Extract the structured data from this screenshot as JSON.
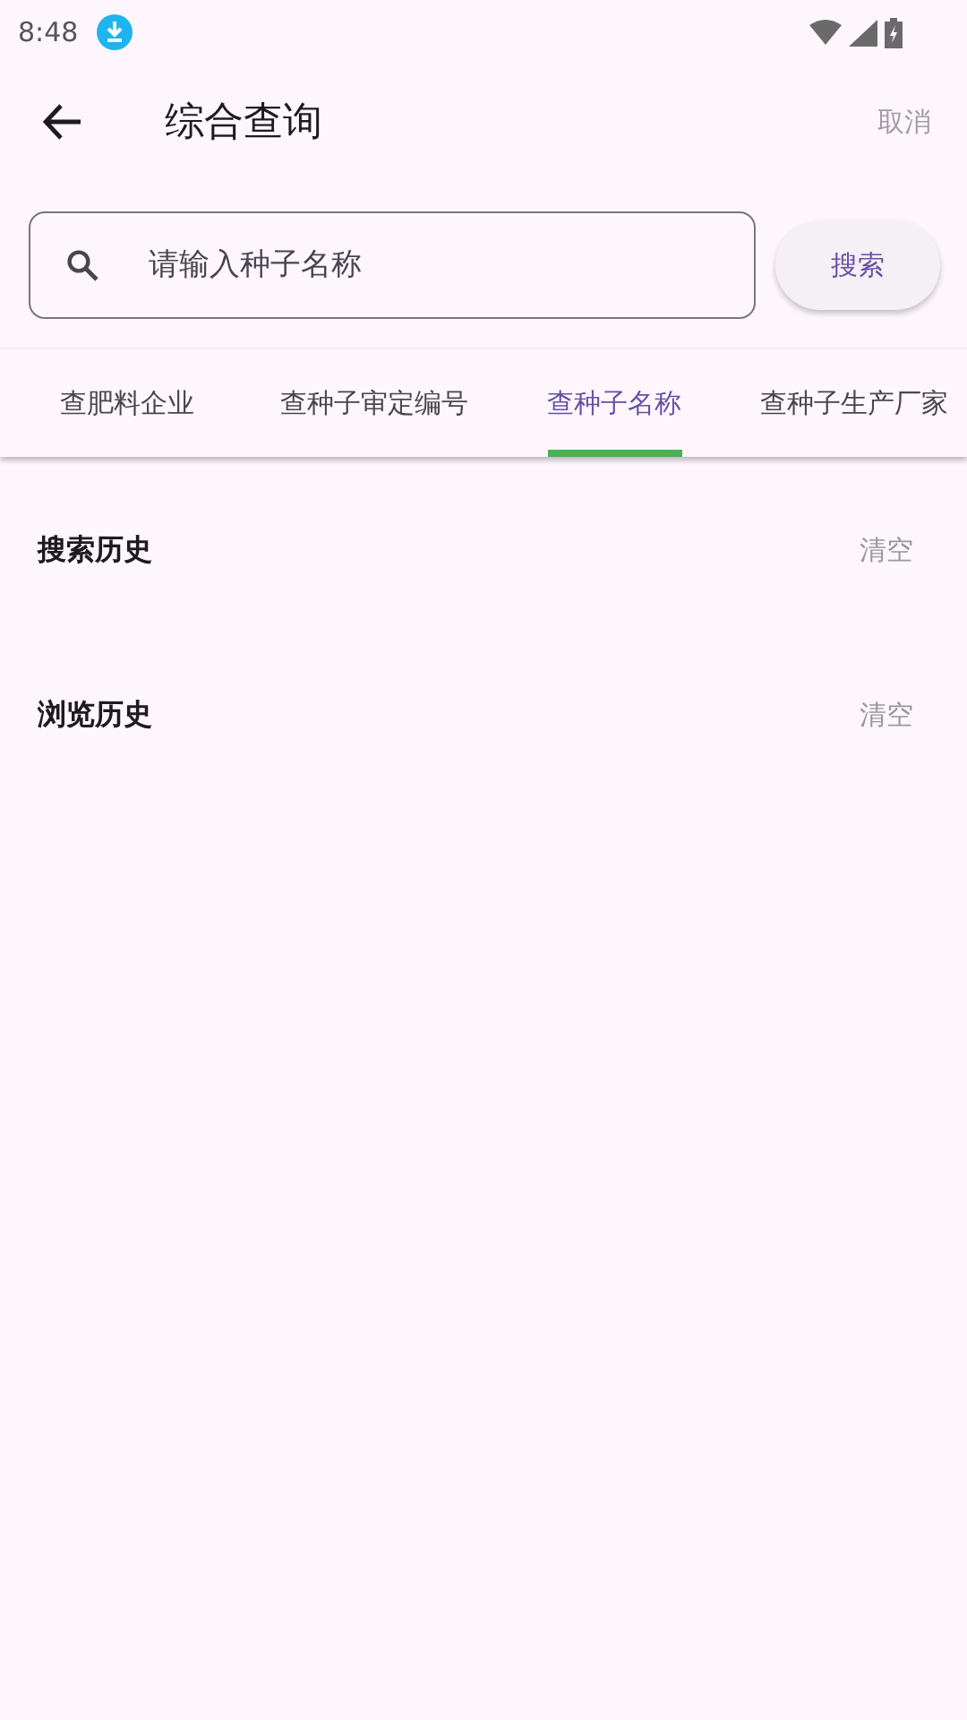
{
  "status_bar": {
    "time": "8:48"
  },
  "app_bar": {
    "title": "综合查询",
    "action": "取消"
  },
  "search": {
    "placeholder": "请输入种子名称",
    "button": "搜索"
  },
  "tabs": [
    {
      "label": "查肥料企业",
      "selected": false
    },
    {
      "label": "查种子审定编号",
      "selected": false
    },
    {
      "label": "查种子名称",
      "selected": true
    },
    {
      "label": "查种子生产厂家",
      "selected": false
    }
  ],
  "sections": [
    {
      "title": "搜索历史",
      "action": "清空"
    },
    {
      "title": "浏览历史",
      "action": "清空"
    }
  ]
}
